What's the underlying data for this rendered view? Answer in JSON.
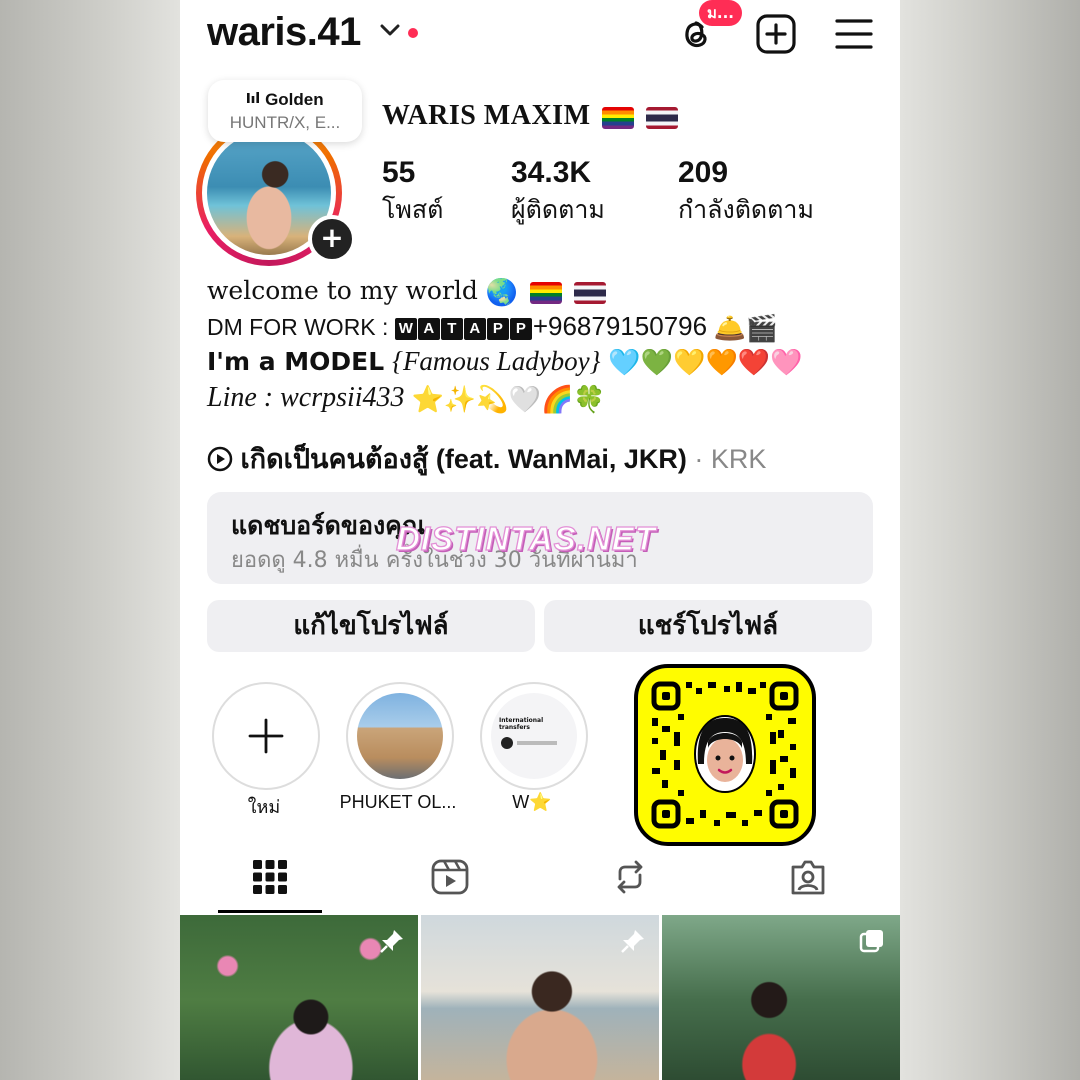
{
  "header": {
    "username": "waris.41",
    "chevron": "⌄",
    "threads_badge": "ม..."
  },
  "note": {
    "title": "Golden",
    "subtitle": "HUNTR/X, E..."
  },
  "profile": {
    "display_name": "WARIS MAXIM",
    "stats": [
      {
        "value": "55",
        "label": "โพสต์"
      },
      {
        "value": "34.3K",
        "label": "ผู้ติดตาม"
      },
      {
        "value": "209",
        "label": "กำลังติดตาม"
      }
    ]
  },
  "bio": {
    "line1": "welcome to my world",
    "line2_prefix": "DM FOR WORK :",
    "line2_boxes": [
      "W",
      "A",
      "T",
      "A",
      "P",
      "P"
    ],
    "line2_number": "+96879150796",
    "line3_a": "I'm a MODEL",
    "line3_b": "{Famous Ladyboy}",
    "line4": "Line : wcrpsii433"
  },
  "music": {
    "title": "เกิดเป็นคนต้องสู้ (feat. WanMai, JKR)",
    "artist": "· KRK"
  },
  "dashboard": {
    "title": "แดชบอร์ดของคุณ",
    "subtitle": "ยอดดู 4.8 หมื่น ครั้งในช่วง 30 วันที่ผ่านมา"
  },
  "watermark": "DISTINTAS.NET",
  "buttons": {
    "edit": "แก้ไขโปรไฟล์",
    "share": "แชร์โปรไฟล์"
  },
  "highlights": [
    {
      "label": "ใหม่"
    },
    {
      "label": "PHUKET OL..."
    },
    {
      "label": "W⭐"
    }
  ],
  "highlight_thumb_text": "International transfers",
  "tabs": [
    "grid-icon",
    "reels-icon",
    "reposts-icon",
    "tagged-icon"
  ],
  "colors": {
    "badge": "#ff2d55",
    "snap_yellow": "#fffc00",
    "panel_gray": "#efeff2"
  }
}
